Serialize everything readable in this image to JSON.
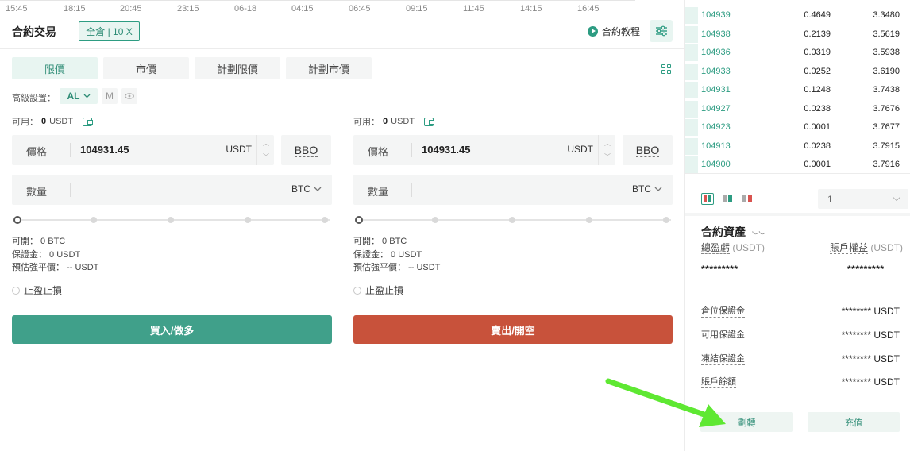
{
  "time_axis": [
    "15:45",
    "18:15",
    "20:45",
    "23:15",
    "06-18",
    "04:15",
    "06:45",
    "09:15",
    "11:45",
    "14:15",
    "16:45"
  ],
  "header": {
    "title": "合約交易",
    "leverage": "全倉 | 10 X",
    "tutorial": "合約教程"
  },
  "order_types": [
    {
      "label": "限價",
      "active": true
    },
    {
      "label": "市價",
      "active": false
    },
    {
      "label": "計劃限價",
      "active": false
    },
    {
      "label": "計劃市價",
      "active": false
    }
  ],
  "advanced": {
    "label": "高級設置：",
    "al": "AL",
    "m": "M"
  },
  "buy": {
    "available_label": "可用：",
    "available_value": "0",
    "available_unit": "USDT",
    "price_label": "價格",
    "price_value": "104931.45",
    "price_unit": "USDT",
    "bbo": "BBO",
    "qty_label": "數量",
    "qty_unit": "BTC",
    "can_open": "可開： 0 BTC",
    "margin": "保證金： 0 USDT",
    "liq_price": "預估強平價： -- USDT",
    "tpsl": "止盈止損",
    "button": "買入/做多"
  },
  "sell": {
    "available_label": "可用：",
    "available_value": "0",
    "available_unit": "USDT",
    "price_label": "價格",
    "price_value": "104931.45",
    "price_unit": "USDT",
    "bbo": "BBO",
    "qty_label": "數量",
    "qty_unit": "BTC",
    "can_open": "可開： 0 BTC",
    "margin": "保證金： 0 USDT",
    "liq_price": "預估強平價： -- USDT",
    "tpsl": "止盈止損",
    "button": "賣出/開空"
  },
  "order_book": [
    {
      "price": "104939",
      "qty": "0.4649",
      "total": "3.3480"
    },
    {
      "price": "104938",
      "qty": "0.2139",
      "total": "3.5619"
    },
    {
      "price": "104936",
      "qty": "0.0319",
      "total": "3.5938"
    },
    {
      "price": "104933",
      "qty": "0.0252",
      "total": "3.6190"
    },
    {
      "price": "104931",
      "qty": "0.1248",
      "total": "3.7438"
    },
    {
      "price": "104927",
      "qty": "0.0238",
      "total": "3.7676"
    },
    {
      "price": "104923",
      "qty": "0.0001",
      "total": "3.7677"
    },
    {
      "price": "104913",
      "qty": "0.0238",
      "total": "3.7915"
    },
    {
      "price": "104900",
      "qty": "0.0001",
      "total": "3.7916"
    }
  ],
  "depth_select": "1",
  "assets": {
    "title": "合約資產",
    "total_pnl_label": "總盈虧",
    "total_pnl_unit": "(USDT)",
    "equity_label": "賬戶權益",
    "equity_unit": "(USDT)",
    "total_pnl_value": "*********",
    "equity_value": "*********",
    "rows": [
      {
        "label": "倉位保證金",
        "value": "******** USDT"
      },
      {
        "label": "可用保證金",
        "value": "******** USDT"
      },
      {
        "label": "凍結保證金",
        "value": "******** USDT"
      },
      {
        "label": "賬戶餘額",
        "value": "******** USDT"
      }
    ],
    "transfer": "劃轉",
    "deposit": "充值"
  },
  "colors": {
    "accent": "#2d9c82",
    "buy": "#40a08a",
    "sell": "#c8523b",
    "annotation_arrow": "#5ee832"
  }
}
